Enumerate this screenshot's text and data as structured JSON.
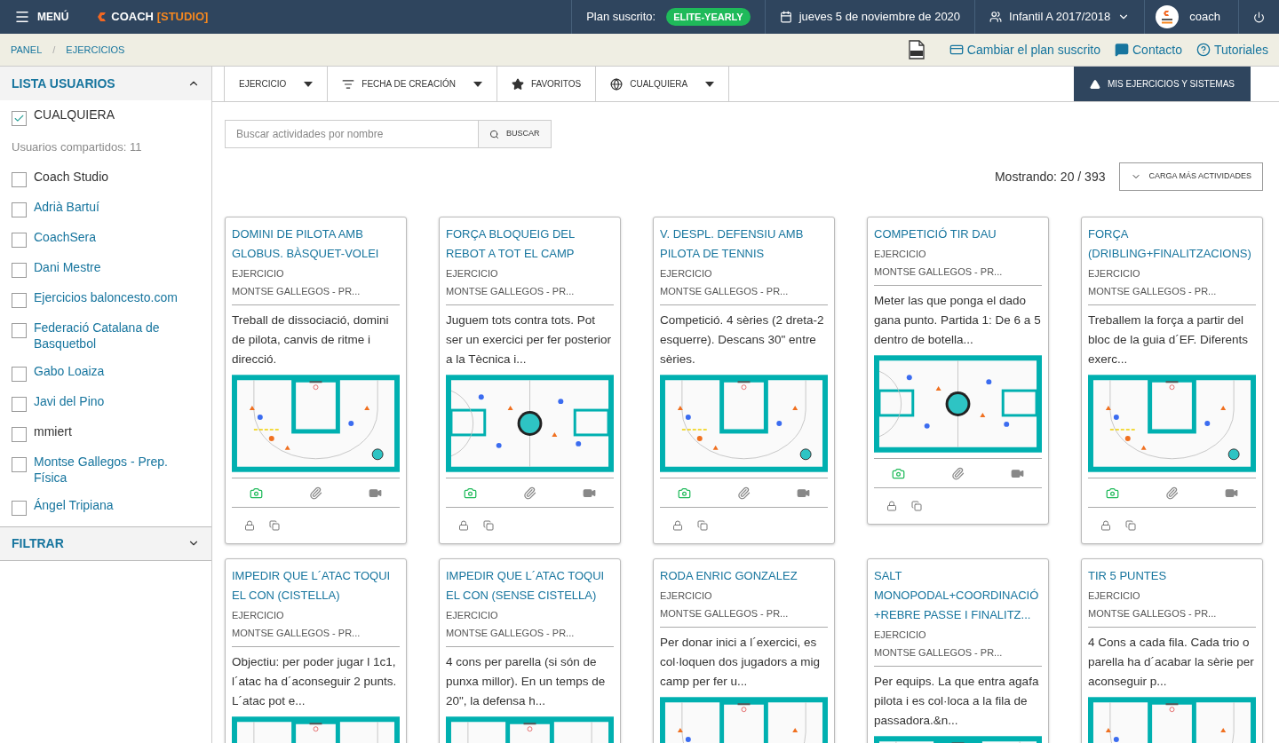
{
  "topbar": {
    "menu": "MENÚ",
    "logo_main": "COACH",
    "logo_accent": "[STUDIO]",
    "plan_label": "Plan suscrito:",
    "plan_badge": "ELITE-YEARLY",
    "date": "jueves 5 de noviembre de 2020",
    "team": "Infantil A 2017/2018",
    "user": "coach"
  },
  "breadcrumbs": [
    "PANEL",
    "EJERCICIOS"
  ],
  "breadcrumb_separator": "/",
  "actions": [
    {
      "kind": "pdf"
    },
    {
      "kind": "card",
      "label": "Cambiar el plan suscrito"
    },
    {
      "kind": "chat",
      "label": "Contacto"
    },
    {
      "kind": "help",
      "label": "Tutoriales"
    }
  ],
  "sidebar": {
    "title": "LISTA USUARIOS",
    "expanded": true,
    "any": {
      "label": "CUALQUIERA",
      "checked": true
    },
    "shared": "Usuarios compartidos: 11",
    "users": [
      {
        "name": "Coach Studio",
        "kind": "plain",
        "checked": false
      },
      {
        "name": "Adrià Bartuí",
        "kind": "link",
        "checked": false
      },
      {
        "name": "CoachSera",
        "kind": "link",
        "checked": false
      },
      {
        "name": "Dani Mestre",
        "kind": "link",
        "checked": false
      },
      {
        "name": "Ejercicios baloncesto.com",
        "kind": "link",
        "checked": false
      },
      {
        "name": "Federació Catalana de Basquetbol",
        "kind": "link",
        "checked": false
      },
      {
        "name": "Gabo Loaiza",
        "kind": "link",
        "checked": false
      },
      {
        "name": "Javi del Pino",
        "kind": "link",
        "checked": false
      },
      {
        "name": "mmiert",
        "kind": "plain",
        "checked": false
      },
      {
        "name": "Montse Gallegos - Prep. Física",
        "kind": "link",
        "checked": false
      },
      {
        "name": "Ángel Tripiana",
        "kind": "link",
        "checked": false
      }
    ],
    "filter": {
      "title": "FILTRAR",
      "expanded": false
    }
  },
  "toolbar": [
    {
      "kind": "dropdown",
      "label": "EJERCICIO"
    },
    {
      "kind": "sort",
      "label": "FECHA DE CREACIÓN"
    },
    {
      "kind": "star",
      "label": "FAVORITOS"
    },
    {
      "kind": "globe",
      "label": "CUALQUIERA"
    }
  ],
  "my_button": "MIS EJERCICIOS Y SISTEMAS",
  "search": {
    "placeholder": "Buscar actividades por nombre",
    "button": "BUSCAR"
  },
  "count": "Mostrando: 20 / 393",
  "load_more": "CARGA MÁS ACTIVIDADES",
  "cards": [
    {
      "title": "DOMINI DE PILOTA AMB GLOBUS. BÀSQUET-VOLEI",
      "type": "EJERCICIO",
      "author": "MONTSE GALLEGOS - PR...",
      "description": "Treball de dissociació, domini de pilota, canvis de ritme i direcció.",
      "court_full": false
    },
    {
      "title": "FORÇA BLOQUEIG DEL REBOT A TOT EL CAMP",
      "type": "EJERCICIO",
      "author": "MONTSE GALLEGOS - PR...",
      "description": "Juguem tots contra tots. Pot ser un exercici per fer posterior a la Tècnica i...",
      "court_full": true
    },
    {
      "title": "V. DESPL. DEFENSIU AMB PILOTA DE TENNIS",
      "type": "EJERCICIO",
      "author": "MONTSE GALLEGOS - PR...",
      "description": "Competició. 4 sèries (2 dreta-2 esquerre). Descans 30\" entre sèries.",
      "court_full": false
    },
    {
      "title": "COMPETICIÓ TIR DAU",
      "type": "EJERCICIO",
      "author": "MONTSE GALLEGOS - PR...",
      "description": "Meter las que ponga el dado gana punto. Partida 1: De 6 a 5 dentro de botella...",
      "court_full": true
    },
    {
      "title": "FORÇA (DRIBLING+FINALITZACIONS)",
      "type": "EJERCICIO",
      "author": "MONTSE GALLEGOS - PR...",
      "description": "Treballem la força a partir del bloc de la guia d´EF. Diferents exerc...",
      "court_full": false
    },
    {
      "title": "IMPEDIR QUE L´ATAC TOQUI EL CON (CISTELLA)",
      "type": "EJERCICIO",
      "author": "MONTSE GALLEGOS - PR...",
      "description": "Objectiu: per poder jugar l 1c1, l´atac ha d´aconseguir 2 punts. L´atac pot e...",
      "court_full": false
    },
    {
      "title": "IMPEDIR QUE L´ATAC TOQUI EL CON (SENSE CISTELLA)",
      "type": "EJERCICIO",
      "author": "MONTSE GALLEGOS - PR...",
      "description": "4 cons per parella (si són de punxa millor). En un temps de 20\", la defensa h...",
      "court_full": false
    },
    {
      "title": "RODA ENRIC GONZALEZ",
      "type": "EJERCICIO",
      "author": "MONTSE GALLEGOS - PR...",
      "description": "Per donar inici a l´exercici, es col·loquen dos jugadors a mig camp per fer u...",
      "court_full": false
    },
    {
      "title": "SALT MONOPODAL+COORDINACIÓ+REBRE PASSE I FINALITZ...",
      "type": "EJERCICIO",
      "author": "MONTSE GALLEGOS - PR...",
      "description": "Per equips. La que entra agafa pilota i es col·loca a la fila de passadora.&n...",
      "court_full": false
    },
    {
      "title": "TIR 5 PUNTES",
      "type": "EJERCICIO",
      "author": "MONTSE GALLEGOS - PR...",
      "description": "4 Cons a cada fila. Cada trio o parella ha d´acabar la sèrie per aconseguir p...",
      "court_full": false
    }
  ]
}
